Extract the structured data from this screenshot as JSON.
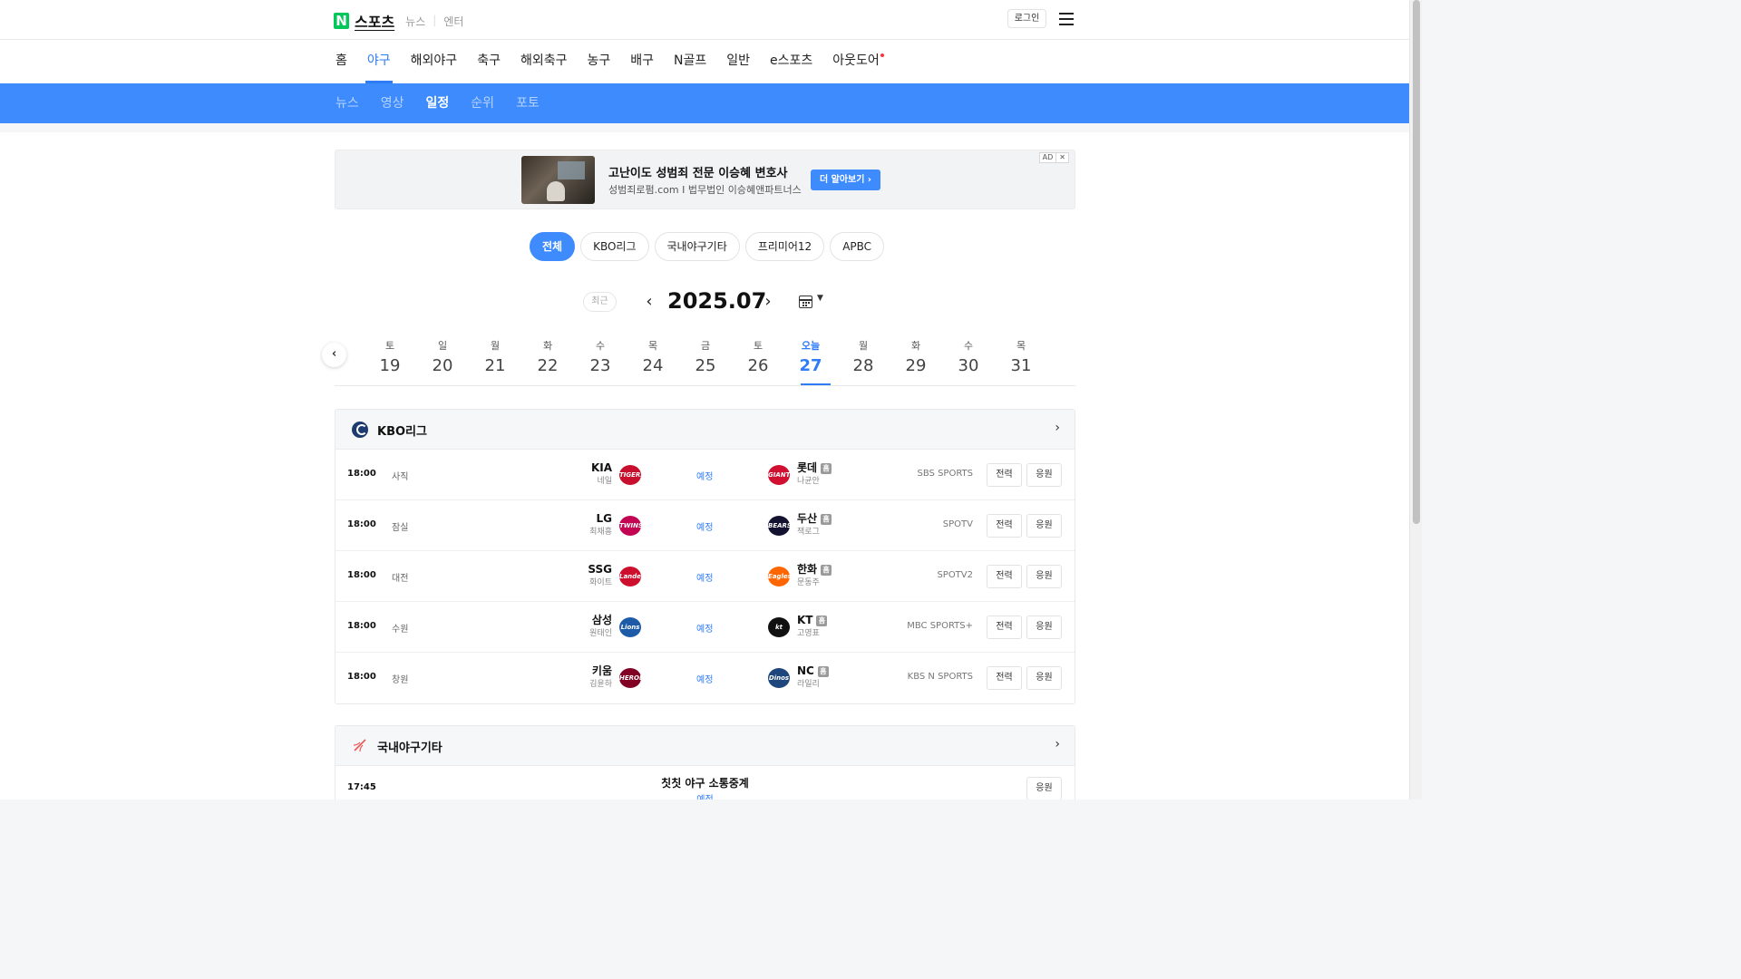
{
  "header": {
    "logo_letter": "N",
    "site_title": "스포츠",
    "links": [
      "뉴스",
      "엔터"
    ],
    "login_label": "로그인"
  },
  "category_nav": {
    "items": [
      "홈",
      "야구",
      "해외야구",
      "축구",
      "해외축구",
      "농구",
      "배구",
      "N골프",
      "일반",
      "e스포츠",
      "아웃도어"
    ],
    "active": "야구"
  },
  "sub_nav": {
    "items": [
      "뉴스",
      "영상",
      "일정",
      "순위",
      "포토"
    ],
    "active": "일정"
  },
  "ad": {
    "headline": "고난이도 성범죄 전문 이승혜 변호사",
    "description": "성범죄로펌.com I 법무법인 이승혜앤파트너스",
    "cta": "더 알아보기 ›",
    "badge": "AD",
    "close": "✕"
  },
  "filters": {
    "items": [
      "전체",
      "KBO리그",
      "국내야구기타",
      "프리미어12",
      "APBC"
    ],
    "active": "전체"
  },
  "calendar": {
    "recent_label": "최근",
    "month": "2025.07",
    "prev": "‹",
    "next": "›",
    "days": [
      {
        "dow": "토",
        "num": "19"
      },
      {
        "dow": "일",
        "num": "20"
      },
      {
        "dow": "월",
        "num": "21"
      },
      {
        "dow": "화",
        "num": "22"
      },
      {
        "dow": "수",
        "num": "23"
      },
      {
        "dow": "목",
        "num": "24"
      },
      {
        "dow": "금",
        "num": "25"
      },
      {
        "dow": "토",
        "num": "26"
      },
      {
        "dow": "오늘",
        "num": "27",
        "today": true
      },
      {
        "dow": "월",
        "num": "28"
      },
      {
        "dow": "화",
        "num": "29"
      },
      {
        "dow": "수",
        "num": "30"
      },
      {
        "dow": "목",
        "num": "31"
      }
    ]
  },
  "kbo": {
    "name": "KBO리그",
    "games": [
      {
        "time": "18:00",
        "venue": "사직",
        "home": "KIA",
        "home_pitcher": "네일",
        "home_logo_text": "TIGERS",
        "home_color": "#c8102e",
        "status": "예정",
        "away": "롯데",
        "away_pitcher": "나균안",
        "away_logo_text": "GIANTS",
        "away_color": "#d00f31",
        "badge": "홈",
        "tv": "SBS SPORTS",
        "btn1": "전력",
        "btn2": "응원"
      },
      {
        "time": "18:00",
        "venue": "잠실",
        "home": "LG",
        "home_pitcher": "최채흥",
        "home_logo_text": "TWINS",
        "home_color": "#c30452",
        "status": "예정",
        "away": "두산",
        "away_pitcher": "잭로그",
        "away_logo_text": "BEARS",
        "away_color": "#131230",
        "badge": "홈",
        "tv": "SPOTV",
        "btn1": "전력",
        "btn2": "응원"
      },
      {
        "time": "18:00",
        "venue": "대전",
        "home": "SSG",
        "home_pitcher": "화이트",
        "home_logo_text": "Landers",
        "home_color": "#ce0e2d",
        "status": "예정",
        "away": "한화",
        "away_pitcher": "문동주",
        "away_logo_text": "Eagles",
        "away_color": "#ff6600",
        "badge": "홈",
        "tv": "SPOTV2",
        "btn1": "전력",
        "btn2": "응원"
      },
      {
        "time": "18:00",
        "venue": "수원",
        "home": "삼성",
        "home_pitcher": "원태인",
        "home_logo_text": "Lions",
        "home_color": "#1d5ba8",
        "status": "예정",
        "away": "KT",
        "away_pitcher": "고영표",
        "away_logo_text": "kt",
        "away_color": "#111111",
        "badge": "홈",
        "tv": "MBC SPORTS+",
        "btn1": "전력",
        "btn2": "응원"
      },
      {
        "time": "18:00",
        "venue": "창원",
        "home": "키움",
        "home_pitcher": "김윤하",
        "home_logo_text": "HEROES",
        "home_color": "#820024",
        "status": "예정",
        "away": "NC",
        "away_pitcher": "라일리",
        "away_logo_text": "Dinos",
        "away_color": "#1d467c",
        "badge": "홈",
        "tv": "KBS N SPORTS",
        "btn1": "전력",
        "btn2": "응원"
      }
    ]
  },
  "domestic_other": {
    "name": "국내야구기타",
    "games": [
      {
        "time": "17:45",
        "title": "칫칫 야구 소통중계",
        "status": "예정",
        "btn": "응원"
      }
    ]
  }
}
